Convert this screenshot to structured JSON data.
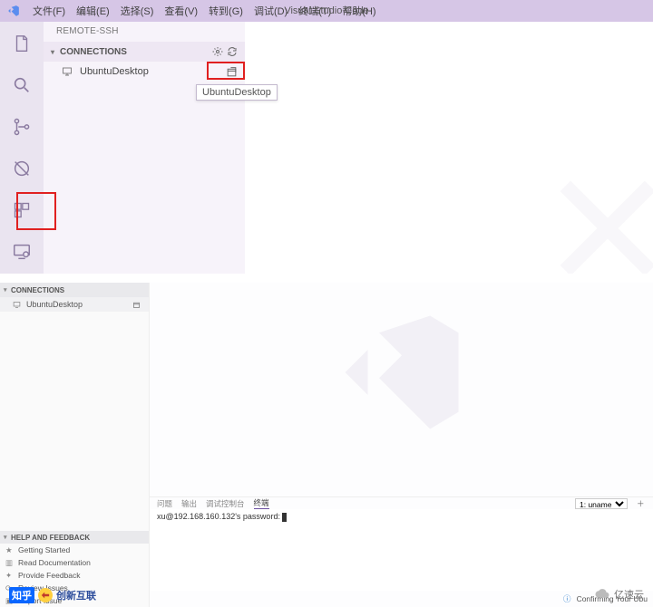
{
  "top": {
    "app_title": "Visual Studio Code",
    "menus": [
      "文件(F)",
      "编辑(E)",
      "选择(S)",
      "查看(V)",
      "转到(G)",
      "调试(D)",
      "终端(T)",
      "帮助(H)"
    ],
    "sidebar": {
      "title": "REMOTE-SSH",
      "section": "CONNECTIONS",
      "host": "UbuntuDesktop",
      "tooltip": "UbuntuDesktop"
    }
  },
  "bottom": {
    "connections": {
      "section": "CONNECTIONS",
      "host": "UbuntuDesktop"
    },
    "help": {
      "section": "HELP AND FEEDBACK",
      "links": [
        "Getting Started",
        "Read Documentation",
        "Provide Feedback",
        "Review Issues",
        "Report Issue"
      ]
    },
    "terminal": {
      "tabs": [
        "问题",
        "输出",
        "调试控制台",
        "终端"
      ],
      "active_tab": 3,
      "selector": "1: uname",
      "line": "xu@192.168.160.132's password:"
    },
    "statusbar": {
      "msg": "Confirming Your Ubu"
    }
  },
  "watermarks": {
    "left1": "知乎",
    "left2": "创新互联",
    "right": "亿速云"
  }
}
